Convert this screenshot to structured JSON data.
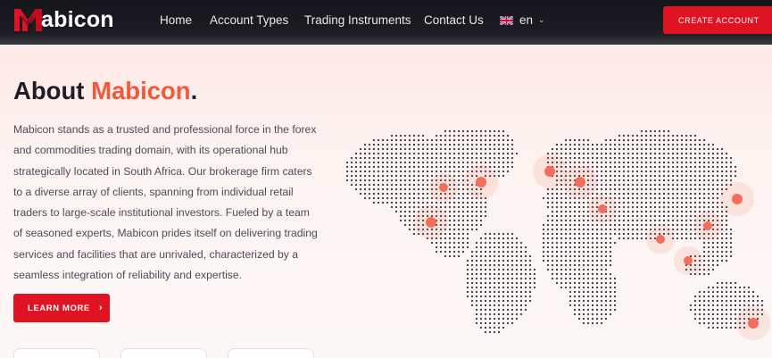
{
  "header": {
    "logo_text": "abicon",
    "nav": [
      "Home",
      "Account Types",
      "Trading Instruments",
      "Contact Us"
    ],
    "language": "en",
    "cta_label": "CREATE ACCOUNT"
  },
  "about": {
    "title_prefix": "About ",
    "title_brand": "Mabicon",
    "title_suffix": ".",
    "paragraph": "Mabicon stands as a trusted and professional force in the forex and commodities trading domain, with its operational hub strategically located in South Africa. Our brokerage firm caters to a diverse array of clients, spanning from individual retail traders to large-scale institutional investors. Fueled by a team of seasoned experts, Mabicon prides itself on delivering trading services and facilities that are unrivaled, characterized by a seamless integration of reliability and expertise.",
    "button_label": "LEARN MORE"
  },
  "colors": {
    "accent": "#e01322",
    "brand": "#ef5a3c",
    "nav_bg": "#1c1c22",
    "map_dots": "#3b3b45",
    "map_markers": "#f36f5b"
  },
  "icons": {
    "logo": "mabicon-m-logo-icon",
    "language_flag": "uk-flag-icon",
    "language_toggle": "chevron-down-icon",
    "learn_more": "chevron-right-icon"
  }
}
